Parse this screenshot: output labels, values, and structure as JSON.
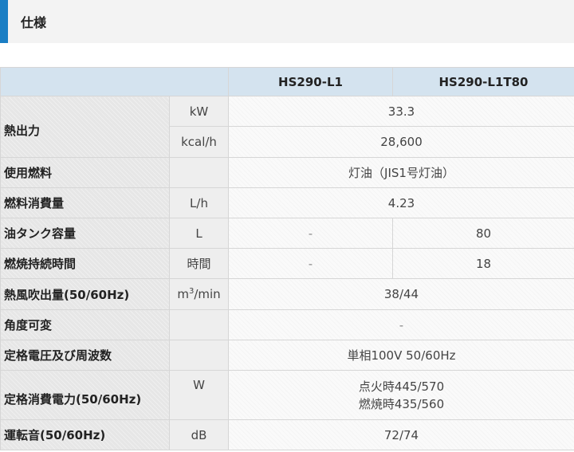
{
  "section": {
    "title": "仕様"
  },
  "header": {
    "models": [
      "HS290-L1",
      "HS290-L1T80"
    ]
  },
  "rows": {
    "heat_output": {
      "item": "熱出力",
      "unit_kw": "kW",
      "value_kw": "33.3",
      "unit_kcal": "kcal/h",
      "value_kcal": "28,600"
    },
    "fuel": {
      "item": "使用燃料",
      "unit": "",
      "value": "灯油（JIS1号灯油）"
    },
    "fuel_consumption": {
      "item": "燃料消費量",
      "unit": "L/h",
      "value": "4.23"
    },
    "tank_capacity": {
      "item": "油タンク容量",
      "unit": "L",
      "value_l1": "-",
      "value_l1t80": "80"
    },
    "burn_time": {
      "item": "燃焼持続時間",
      "unit": "時間",
      "value_l1": "-",
      "value_l1t80": "18"
    },
    "airflow": {
      "item": "熱風吹出量(50/60Hz)",
      "unit_base": "m",
      "unit_sup": "3",
      "unit_rest": "/min",
      "value": "38/44"
    },
    "angle": {
      "item": "角度可変",
      "unit": "",
      "value": "-"
    },
    "voltage": {
      "item": "定格電圧及び周波数",
      "unit": "",
      "value": "単相100V 50/60Hz"
    },
    "power": {
      "item": "定格消費電力(50/60Hz)",
      "unit": "W",
      "value_line1": "点火時445/570",
      "value_line2": "燃焼時435/560"
    },
    "noise": {
      "item": "運転音(50/60Hz)",
      "unit": "dB",
      "value": "72/74"
    }
  },
  "colors": {
    "accent": "#1a7ec4",
    "header_bg": "#d4e3ef",
    "item_bg": "#e6e6e6"
  }
}
